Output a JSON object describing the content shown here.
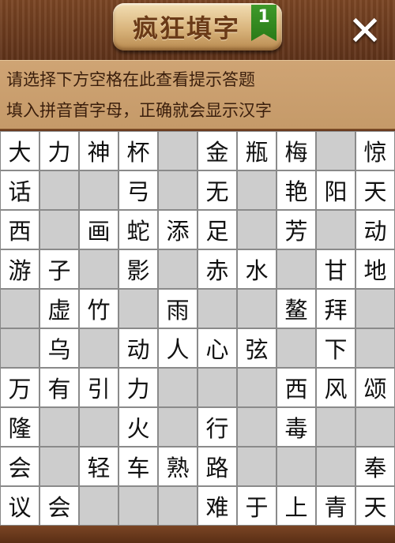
{
  "header": {
    "title": "疯狂填字",
    "level": "1",
    "close_glyph": "✕"
  },
  "hints": {
    "line1": "请选择下方空格在此查看提示答题",
    "line2": "填入拼音首字母，正确就会显示汉字"
  },
  "grid": {
    "rows": [
      [
        "大",
        "力",
        "神",
        "杯",
        null,
        "金",
        "瓶",
        "梅",
        null,
        "惊"
      ],
      [
        "话",
        null,
        null,
        "弓",
        null,
        "无",
        null,
        "艳",
        "阳",
        "天"
      ],
      [
        "西",
        null,
        "画",
        "蛇",
        "添",
        "足",
        null,
        "芳",
        null,
        "动"
      ],
      [
        "游",
        "子",
        null,
        "影",
        null,
        "赤",
        "水",
        null,
        "甘",
        "地"
      ],
      [
        null,
        "虚",
        "竹",
        null,
        "雨",
        null,
        null,
        "鳌",
        "拜",
        null
      ],
      [
        null,
        "乌",
        null,
        "动",
        "人",
        "心",
        "弦",
        null,
        "下",
        null
      ],
      [
        "万",
        "有",
        "引",
        "力",
        null,
        null,
        null,
        "西",
        "风",
        "颂"
      ],
      [
        "隆",
        null,
        null,
        "火",
        null,
        "行",
        null,
        "毒",
        null,
        null
      ],
      [
        "会",
        null,
        "轻",
        "车",
        "熟",
        "路",
        null,
        null,
        null,
        "奉"
      ],
      [
        "议",
        "会",
        null,
        null,
        null,
        "难",
        "于",
        "上",
        "青",
        "天"
      ]
    ]
  }
}
